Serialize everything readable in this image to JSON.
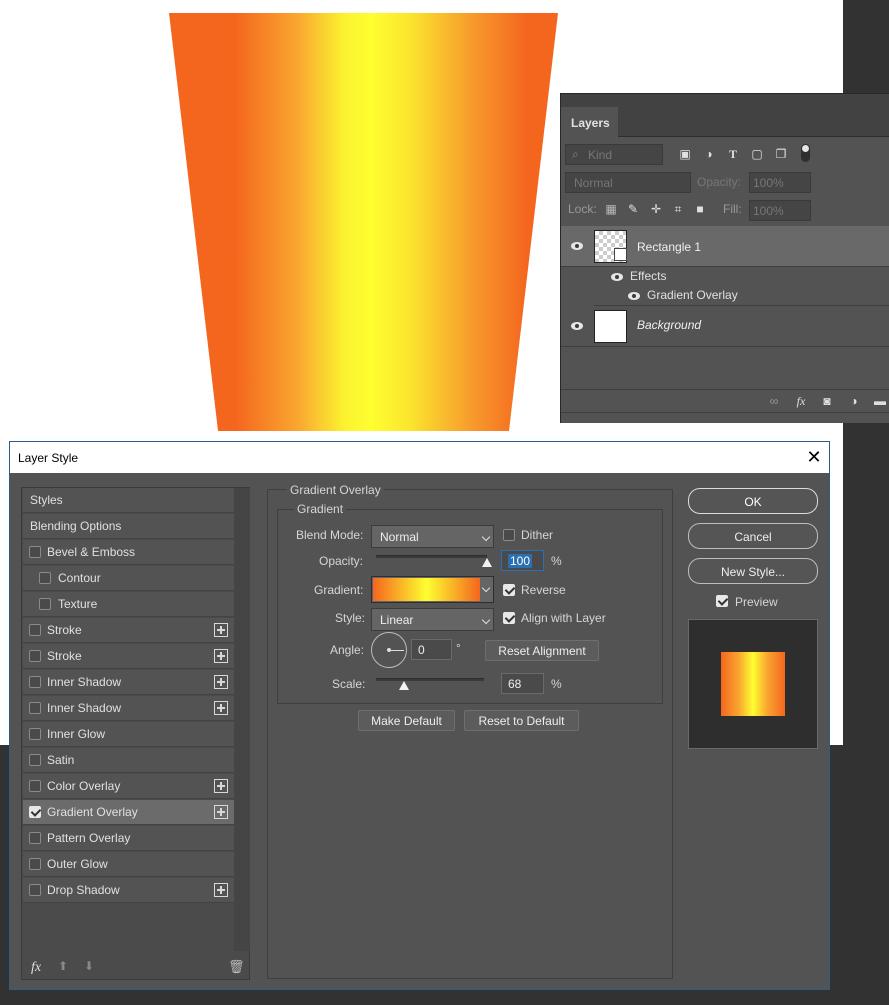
{
  "layers_panel": {
    "tab_label": "Layers",
    "filter_kind": "Kind",
    "blend_mode": "Normal",
    "opacity_label": "Opacity:",
    "opacity_value": "100%",
    "lock_label": "Lock:",
    "fill_label": "Fill:",
    "fill_value": "100%",
    "layers": [
      {
        "name": "Rectangle 1"
      },
      {
        "name": "Background"
      }
    ],
    "effects_label": "Effects",
    "effect_name": "Gradient Overlay"
  },
  "dialog": {
    "title": "Layer Style",
    "styles_list": [
      {
        "label": "Styles",
        "checkbox": false,
        "checked": false,
        "plus": false,
        "indent": false,
        "selected": false
      },
      {
        "label": "Blending Options",
        "checkbox": false,
        "checked": false,
        "plus": false,
        "indent": false,
        "selected": false
      },
      {
        "label": "Bevel & Emboss",
        "checkbox": true,
        "checked": false,
        "plus": false,
        "indent": false,
        "selected": false
      },
      {
        "label": "Contour",
        "checkbox": true,
        "checked": false,
        "plus": false,
        "indent": true,
        "selected": false
      },
      {
        "label": "Texture",
        "checkbox": true,
        "checked": false,
        "plus": false,
        "indent": true,
        "selected": false
      },
      {
        "label": "Stroke",
        "checkbox": true,
        "checked": false,
        "plus": true,
        "indent": false,
        "selected": false
      },
      {
        "label": "Stroke",
        "checkbox": true,
        "checked": false,
        "plus": true,
        "indent": false,
        "selected": false
      },
      {
        "label": "Inner Shadow",
        "checkbox": true,
        "checked": false,
        "plus": true,
        "indent": false,
        "selected": false
      },
      {
        "label": "Inner Shadow",
        "checkbox": true,
        "checked": false,
        "plus": true,
        "indent": false,
        "selected": false
      },
      {
        "label": "Inner Glow",
        "checkbox": true,
        "checked": false,
        "plus": false,
        "indent": false,
        "selected": false
      },
      {
        "label": "Satin",
        "checkbox": true,
        "checked": false,
        "plus": false,
        "indent": false,
        "selected": false
      },
      {
        "label": "Color Overlay",
        "checkbox": true,
        "checked": false,
        "plus": true,
        "indent": false,
        "selected": false
      },
      {
        "label": "Gradient Overlay",
        "checkbox": true,
        "checked": true,
        "plus": true,
        "indent": false,
        "selected": true
      },
      {
        "label": "Pattern Overlay",
        "checkbox": true,
        "checked": false,
        "plus": false,
        "indent": false,
        "selected": false
      },
      {
        "label": "Outer Glow",
        "checkbox": true,
        "checked": false,
        "plus": false,
        "indent": false,
        "selected": false
      },
      {
        "label": "Drop Shadow",
        "checkbox": true,
        "checked": false,
        "plus": true,
        "indent": false,
        "selected": false
      }
    ],
    "section_title": "Gradient Overlay",
    "subsection_title": "Gradient",
    "blend_mode_label": "Blend Mode:",
    "blend_mode_value": "Normal",
    "dither_label": "Dither",
    "opacity_label": "Opacity:",
    "opacity_value": "100",
    "opacity_unit": "%",
    "opacity_level": 1.0,
    "gradient_label": "Gradient:",
    "reverse_label": "Reverse",
    "style_label": "Style:",
    "style_value": "Linear",
    "align_label": "Align with Layer",
    "angle_label": "Angle:",
    "angle_value": "0",
    "angle_unit": "°",
    "reset_alignment": "Reset Alignment",
    "scale_label": "Scale:",
    "scale_value": "68",
    "scale_unit": "%",
    "scale_level": 0.26,
    "make_default": "Make Default",
    "reset_default": "Reset to Default",
    "ok": "OK",
    "cancel": "Cancel",
    "new_style": "New Style...",
    "preview_label": "Preview",
    "fx_label": "fx"
  },
  "colors": {
    "gradient_orange": "#f4661e",
    "gradient_yellow": "#fefe30",
    "selection_blue": "#2b6fb2"
  }
}
